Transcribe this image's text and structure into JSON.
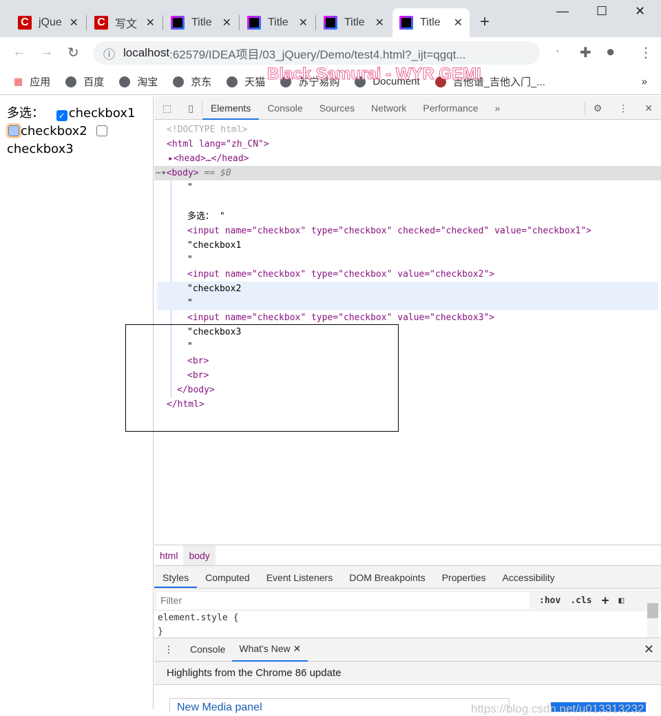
{
  "browser": {
    "tabs": [
      {
        "label": "jQue",
        "icon": "csdn-icon"
      },
      {
        "label": "写文",
        "icon": "csdn-icon"
      },
      {
        "label": "Title",
        "icon": "intellij-icon"
      },
      {
        "label": "Title",
        "icon": "intellij-icon"
      },
      {
        "label": "Title",
        "icon": "intellij-icon"
      },
      {
        "label": "Title",
        "icon": "intellij-icon",
        "active": true
      }
    ],
    "url_host": "localhost",
    "url_path": ":62579/IDEA项目/03_jQuery/Demo/test4.html?_ijt=qgqt...",
    "bookmarks": [
      "应用",
      "百度",
      "淘宝",
      "京东",
      "天猫",
      "苏宁易购",
      "Document",
      "吉他谱_吉他入门_..."
    ],
    "bookmarks_more": "»",
    "watermark": "Black Samurai - WYR GEMI"
  },
  "page": {
    "label": "多选：",
    "checkboxes": [
      {
        "label": "checkbox1",
        "checked": true
      },
      {
        "label": "checkbox2",
        "checked": false
      },
      {
        "label": "checkbox3",
        "checked": false
      }
    ]
  },
  "devtools": {
    "tabs": [
      "Elements",
      "Console",
      "Sources",
      "Network",
      "Performance"
    ],
    "code": {
      "doctype": "<!DOCTYPE html>",
      "html_open": "<html lang=\"zh_CN\">",
      "head": "<head>…</head>",
      "body": "<body>",
      "body_suffix": " == $0",
      "quote": "\"",
      "text1": "多选： \"",
      "input1": "<input name=\"checkbox\" type=\"checkbox\" checked=\"checked\" value=\"checkbox1\">",
      "t_cb1": "\"checkbox1",
      "input2": "<input name=\"checkbox\" type=\"checkbox\" value=\"checkbox2\">",
      "t_cb2": "\"checkbox2",
      "input3": "<input name=\"checkbox\" type=\"checkbox\" value=\"checkbox3\">",
      "t_cb3": "\"checkbox3",
      "br": "<br>",
      "body_close": "</body>",
      "html_close": "</html>"
    },
    "breadcrumb": [
      "html",
      "body"
    ],
    "subtabs": [
      "Styles",
      "Computed",
      "Event Listeners",
      "DOM Breakpoints",
      "Properties",
      "Accessibility"
    ],
    "filter_placeholder": "Filter",
    "hov": ":hov",
    "cls": ".cls",
    "plus": "+",
    "style_rule": "element.style {",
    "style_close": "}",
    "drawer_tabs": [
      "Console",
      "What's New"
    ],
    "highlights": "Highlights from the Chrome 86 update",
    "card_title": "New Media panel",
    "csdn_watermark": "https://blog.csdn.net/u013313232"
  }
}
